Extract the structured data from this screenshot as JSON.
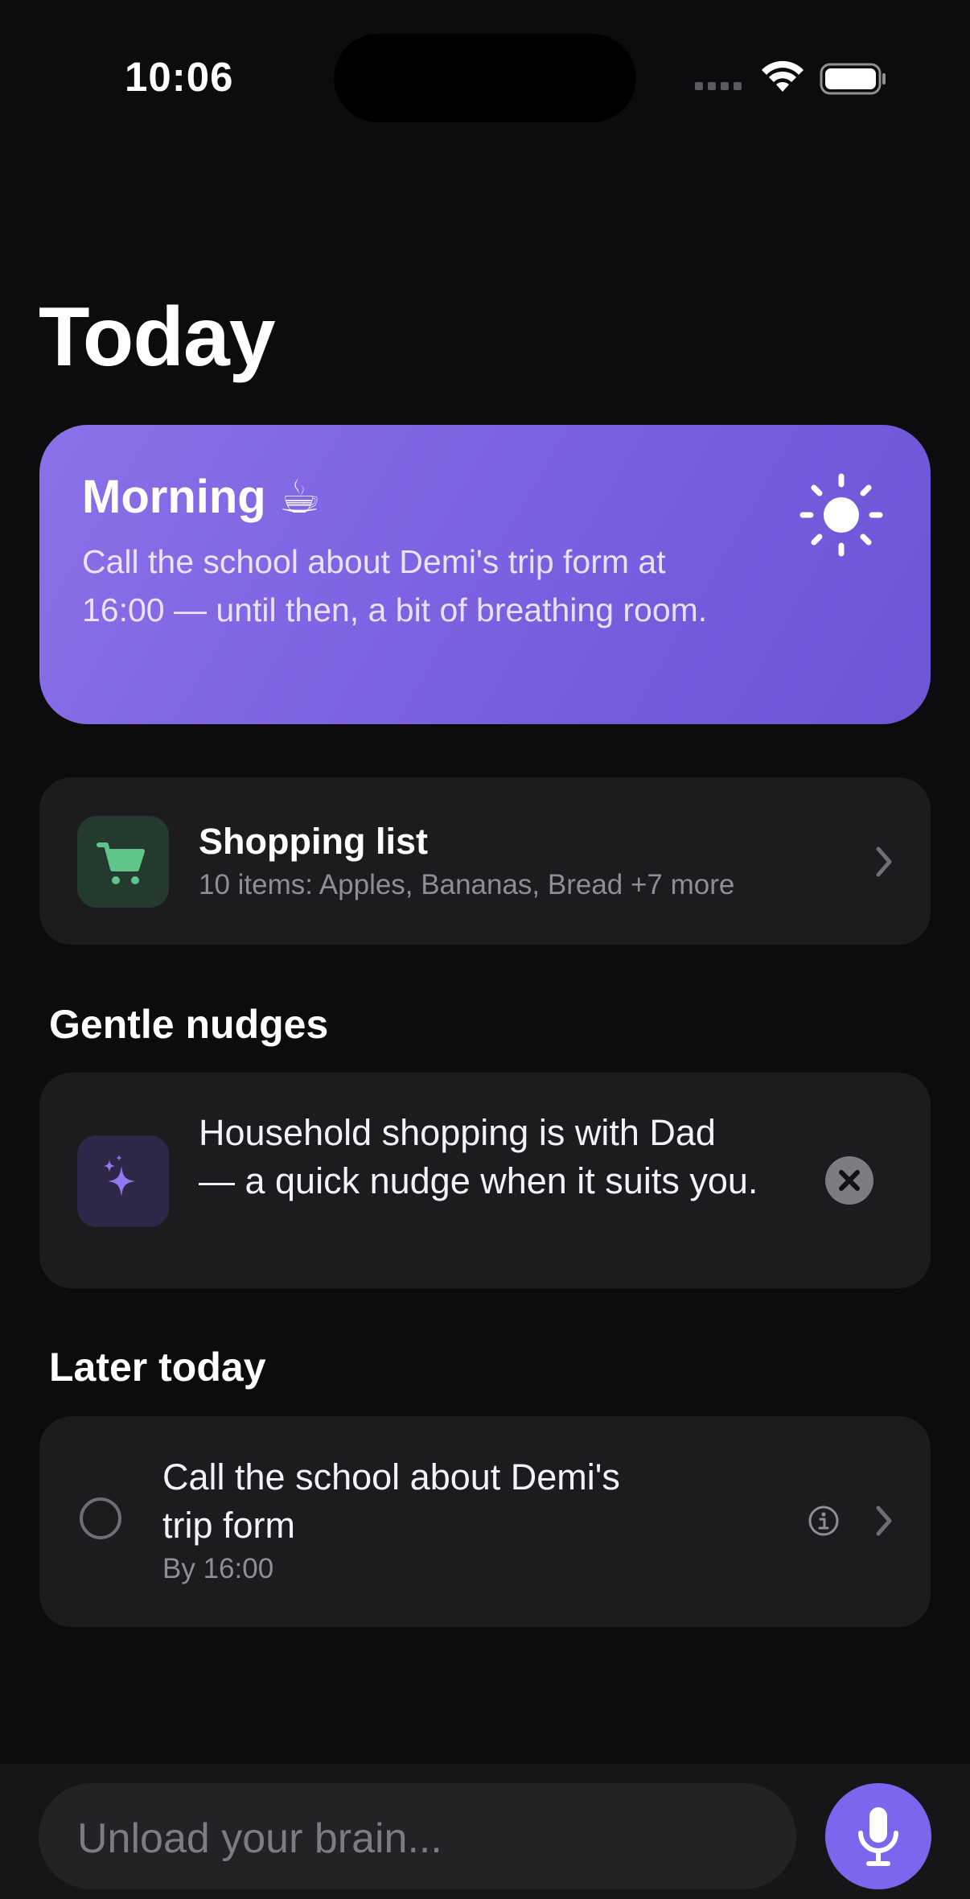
{
  "status_bar": {
    "time": "10:06",
    "icons": [
      "cellular-icon",
      "wifi-icon",
      "battery-icon"
    ]
  },
  "page": {
    "title": "Today"
  },
  "morning_card": {
    "title": "Morning ☕",
    "body": "Call the school about Demi's trip form at 16:00 — until then, a bit of breathing room.",
    "icon": "sun-icon",
    "colors": {
      "gradient_start": "#8c70e8",
      "gradient_end": "#6d55d6"
    }
  },
  "shopping_card": {
    "title": "Shopping list",
    "subtitle": "10 items: Apples, Bananas, Bread +7 more",
    "icon": "cart-icon",
    "accent": "#5fc58a"
  },
  "nudges": {
    "heading": "Gentle nudges",
    "items": [
      {
        "text": "Household shopping is with Dad — a quick nudge when it suits you.",
        "icon": "sparkles-icon"
      }
    ]
  },
  "later": {
    "heading": "Later today",
    "items": [
      {
        "title": "Call the school about Demi's trip form",
        "subtitle": "By 16:00"
      }
    ]
  },
  "composer": {
    "placeholder": "Unload your brain...",
    "mic_color": "#7b66ee"
  }
}
